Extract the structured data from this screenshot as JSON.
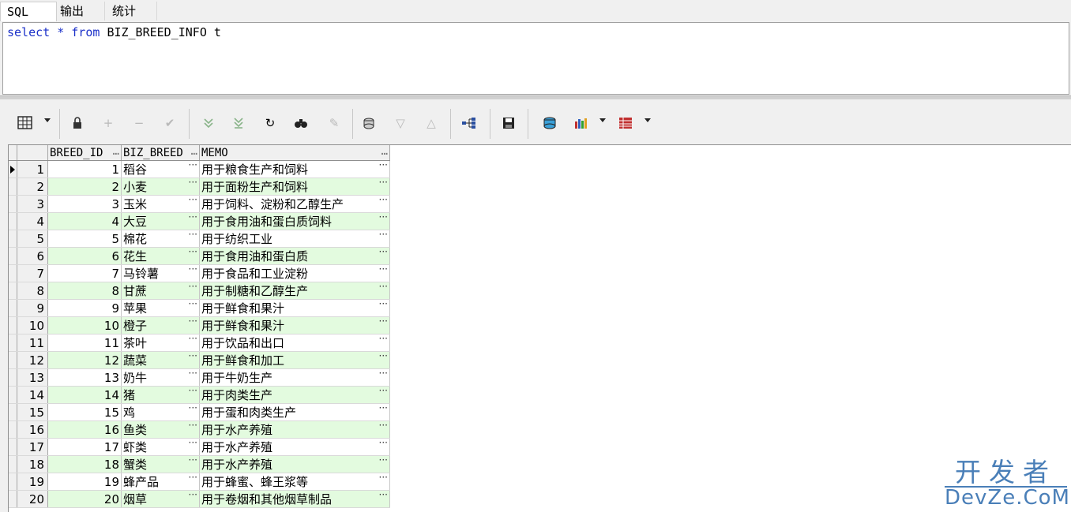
{
  "tabs": [
    {
      "label": "SQL"
    },
    {
      "label": "输出"
    },
    {
      "label": "统计"
    }
  ],
  "editor": {
    "kw1": "select",
    "star": "*",
    "kw2": "from",
    "table": "BIZ_BREED_INFO",
    "alias": "t"
  },
  "toolbar": {
    "icons": [
      "grid-view-icon",
      "lock-icon",
      "add-record-icon",
      "delete-record-icon",
      "post-icon",
      "fetch-next-icon",
      "fetch-all-icon",
      "refresh-icon",
      "find-icon",
      "clear-icon",
      "query-by-example-icon",
      "sort-desc-icon",
      "sort-asc-icon",
      "tree-icon",
      "save-icon",
      "export-icon",
      "chart-icon",
      "table-icon"
    ]
  },
  "grid": {
    "columns": [
      "BREED_ID",
      "BIZ_BREED",
      "MEMO"
    ],
    "rows": [
      {
        "n": "1",
        "id": "1",
        "breed": "稻谷",
        "memo": "用于粮食生产和饲料"
      },
      {
        "n": "2",
        "id": "2",
        "breed": "小麦",
        "memo": "用于面粉生产和饲料"
      },
      {
        "n": "3",
        "id": "3",
        "breed": "玉米",
        "memo": "用于饲料、淀粉和乙醇生产"
      },
      {
        "n": "4",
        "id": "4",
        "breed": "大豆",
        "memo": "用于食用油和蛋白质饲料"
      },
      {
        "n": "5",
        "id": "5",
        "breed": "棉花",
        "memo": "用于纺织工业"
      },
      {
        "n": "6",
        "id": "6",
        "breed": "花生",
        "memo": "用于食用油和蛋白质"
      },
      {
        "n": "7",
        "id": "7",
        "breed": "马铃薯",
        "memo": "用于食品和工业淀粉"
      },
      {
        "n": "8",
        "id": "8",
        "breed": "甘蔗",
        "memo": "用于制糖和乙醇生产"
      },
      {
        "n": "9",
        "id": "9",
        "breed": "苹果",
        "memo": "用于鲜食和果汁"
      },
      {
        "n": "10",
        "id": "10",
        "breed": "橙子",
        "memo": "用于鲜食和果汁"
      },
      {
        "n": "11",
        "id": "11",
        "breed": "茶叶",
        "memo": "用于饮品和出口"
      },
      {
        "n": "12",
        "id": "12",
        "breed": "蔬菜",
        "memo": "用于鲜食和加工"
      },
      {
        "n": "13",
        "id": "13",
        "breed": "奶牛",
        "memo": "用于牛奶生产"
      },
      {
        "n": "14",
        "id": "14",
        "breed": "猪",
        "memo": "用于肉类生产"
      },
      {
        "n": "15",
        "id": "15",
        "breed": "鸡",
        "memo": "用于蛋和肉类生产"
      },
      {
        "n": "16",
        "id": "16",
        "breed": "鱼类",
        "memo": "用于水产养殖"
      },
      {
        "n": "17",
        "id": "17",
        "breed": "虾类",
        "memo": "用于水产养殖"
      },
      {
        "n": "18",
        "id": "18",
        "breed": "蟹类",
        "memo": "用于水产养殖"
      },
      {
        "n": "19",
        "id": "19",
        "breed": "蜂产品",
        "memo": "用于蜂蜜、蜂王浆等"
      },
      {
        "n": "20",
        "id": "20",
        "breed": "烟草",
        "memo": "用于卷烟和其他烟草制品"
      }
    ]
  },
  "watermark": {
    "line1": "开发者",
    "line2": "DevZe.CoM"
  }
}
